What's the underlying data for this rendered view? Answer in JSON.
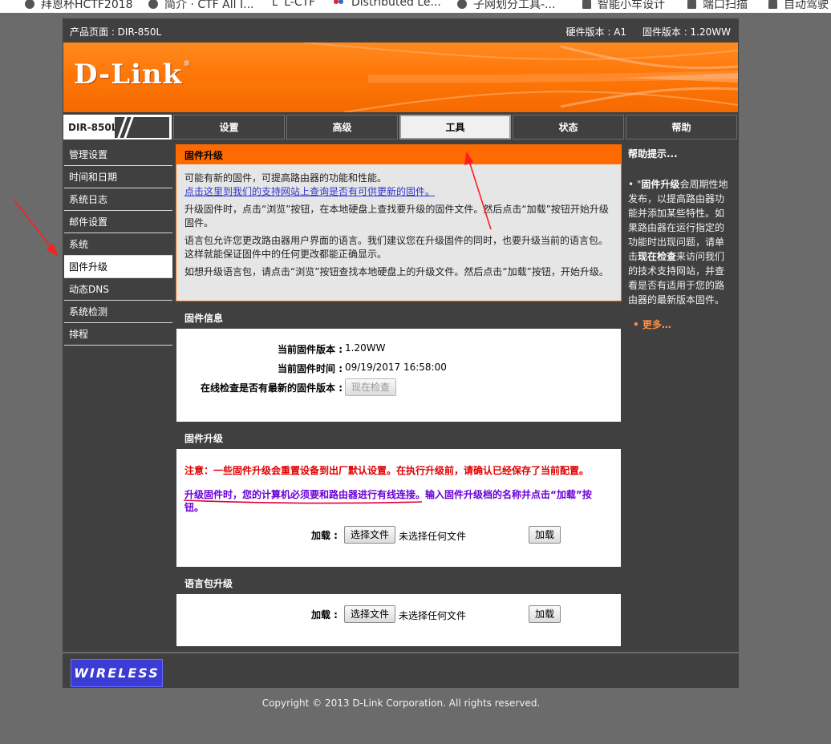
{
  "bookmarks": [
    {
      "label": "拜恩杯HCTF2018",
      "icon": "globe-icon"
    },
    {
      "label": "简介 · CTF All I...",
      "icon": "globe-icon"
    },
    {
      "label": "L-CTF",
      "icon": "l-icon"
    },
    {
      "label": "Distributed Le...",
      "icon": "dx-icon"
    },
    {
      "label": "子网划分工具-...",
      "icon": "globe-icon"
    },
    {
      "label": "智能小车设计",
      "icon": "folder-icon"
    },
    {
      "label": "端口扫描",
      "icon": "folder-icon"
    },
    {
      "label": "自动驾驶",
      "icon": "folder-icon"
    }
  ],
  "top": {
    "product": "产品页面 : DIR-850L",
    "hw": "硬件版本 : A1",
    "fw": "固件版本 : 1.20WW"
  },
  "brand": {
    "logo": "D-Link",
    "trademark": "®"
  },
  "model": "DIR-850L",
  "tabs": [
    {
      "label": "设置",
      "active": false
    },
    {
      "label": "高级",
      "active": false
    },
    {
      "label": "工具",
      "active": true
    },
    {
      "label": "状态",
      "active": false
    },
    {
      "label": "帮助",
      "active": false
    }
  ],
  "sidebar": [
    {
      "label": "管理设置",
      "active": false
    },
    {
      "label": "时间和日期",
      "active": false
    },
    {
      "label": "系统日志",
      "active": false
    },
    {
      "label": "邮件设置",
      "active": false
    },
    {
      "label": "系统",
      "active": false
    },
    {
      "label": "固件升级",
      "active": true
    },
    {
      "label": "动态DNS",
      "active": false
    },
    {
      "label": "系统检测",
      "active": false
    },
    {
      "label": "排程",
      "active": false
    }
  ],
  "upgrade_intro": {
    "title": "固件升级",
    "p1": "可能有新的固件，可提高路由器的功能和性能。",
    "link": "点击这里到我们的支持网站上查询是否有可供更新的固件。",
    "p2": "升级固件时，点击“浏览”按钮，在本地硬盘上查找要升级的固件文件。然后点击“加载”按钮开始升级固件。",
    "p3": "语言包允许您更改路由器用户界面的语言。我们建议您在升级固件的同时，也要升级当前的语言包。这样就能保证固件中的任何更改都能正确显示。",
    "p4": "如想升级语言包，请点击“浏览”按钮查找本地硬盘上的升级文件。然后点击“加载”按钮，开始升级。"
  },
  "firmware_info": {
    "title": "固件信息",
    "version_label": "当前固件版本 :",
    "version_value": "1.20WW",
    "date_label": "当前固件时间 :",
    "date_value": "09/19/2017 16:58:00",
    "check_label": "在线检查是否有最新的固件版本 :",
    "check_button": "现在检查"
  },
  "firmware_upgrade": {
    "title": "固件升级",
    "warning": "注意：一些固件升级会重置设备到出厂默认设置。在执行升级前，请确认已经保存了当前配置。",
    "note": "升级固件时，您的计算机必须要和路由器进行有线连接。输入固件升级档的名称并点击“加载”按钮。",
    "load_label": "加载 :",
    "choose_button": "选择文件",
    "no_file": "未选择任何文件",
    "upload_button": "加载"
  },
  "language_pack": {
    "title": "语言包升级",
    "load_label": "加载 :",
    "choose_button": "选择文件",
    "no_file": "未选择任何文件",
    "upload_button": "加载"
  },
  "hints": {
    "title": "帮助提示...",
    "text_prefix": "•  \"",
    "text_bold1": "固件升级",
    "text_mid": "会周期性地发布，以提高路由器功能并添加某些特性。如果路由器在运行指定的功能时出现问题，请单击",
    "text_bold2": "现在检查",
    "text_end": "来访问我们的技术支持网站，并查看是否有适用于您的路由器的最新版本固件。",
    "more": "•  更多…"
  },
  "footer": {
    "badge": "WIRELESS"
  },
  "copyright": "Copyright © 2013 D-Link Corporation. All rights reserved.",
  "colors": {
    "accent": "#ff6a00",
    "nav_bg": "#404040",
    "warning": "#e00000",
    "note": "#6a00d8",
    "link": "#3333cc",
    "annotation": "#ff0000"
  }
}
